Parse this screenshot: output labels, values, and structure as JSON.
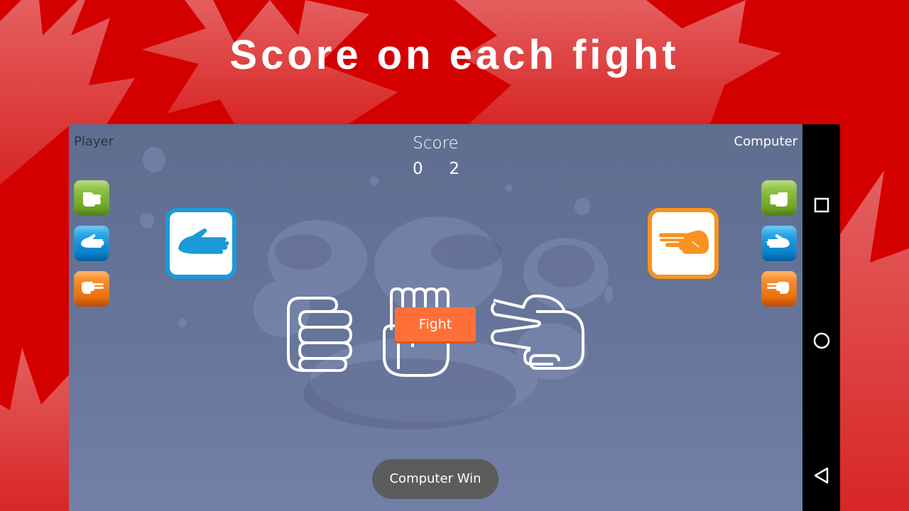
{
  "promo": {
    "title": "Score on each fight"
  },
  "game": {
    "player_label": "Player",
    "computer_label": "Computer",
    "score_title": "Score",
    "score": {
      "player": "0",
      "computer": "2"
    },
    "fight_button": "Fight",
    "result_toast": "Computer Win",
    "player_choice": "paper",
    "computer_choice": "scissors",
    "choice_buttons": [
      {
        "name": "rock",
        "icon": "rock-hand-icon",
        "color": "#7bb12e"
      },
      {
        "name": "paper",
        "icon": "paper-hand-icon",
        "color": "#0f8fd8"
      },
      {
        "name": "scissors",
        "icon": "scissors-hand-icon",
        "color": "#f47a14"
      }
    ],
    "center_hands": [
      "rock",
      "paper",
      "scissors"
    ]
  },
  "navbar": {
    "recents": "recents-icon",
    "home": "home-icon",
    "back": "back-icon"
  },
  "colors": {
    "background_red": "#d40000",
    "screen_blue": "#64729a",
    "fight_orange": "#ff7038",
    "paper_blue": "#1a9ad9",
    "scissors_orange": "#f7931e"
  }
}
